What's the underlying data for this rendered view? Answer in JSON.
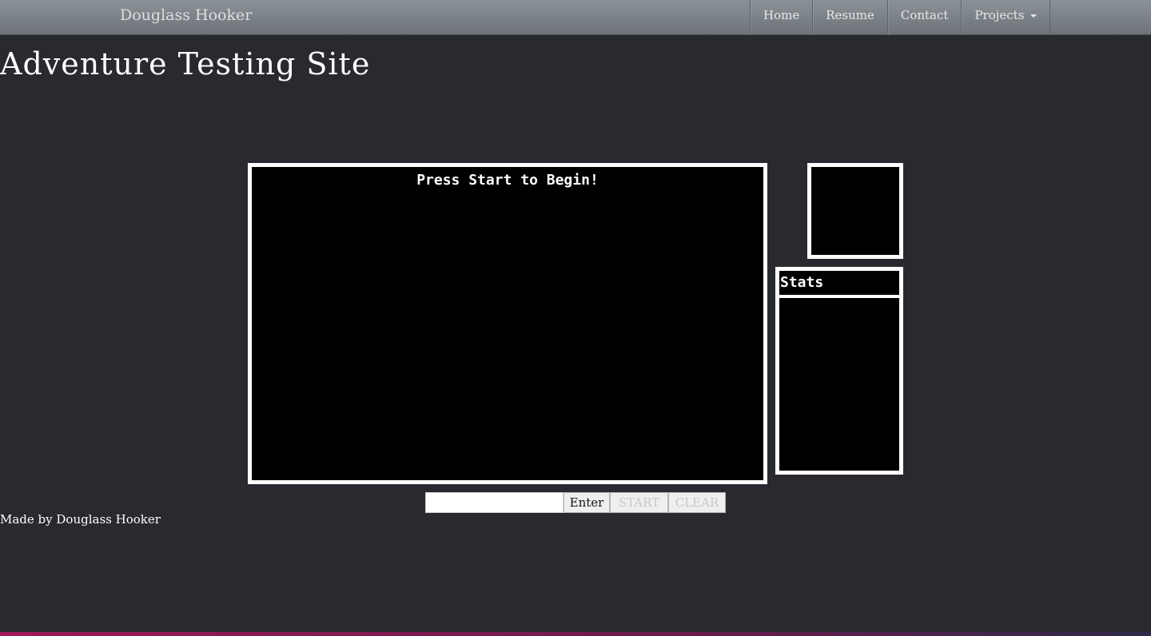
{
  "navbar": {
    "brand": "Douglass Hooker",
    "items": [
      {
        "label": "Home"
      },
      {
        "label": "Resume"
      },
      {
        "label": "Contact"
      },
      {
        "label": "Projects"
      }
    ]
  },
  "page": {
    "title": "Adventure Testing Site"
  },
  "game": {
    "message": "Press Start to Begin!"
  },
  "stats": {
    "header": "Stats"
  },
  "controls": {
    "input_value": "",
    "enter_label": "Enter",
    "start_label": "START",
    "clear_label": "CLEAR"
  },
  "footer": {
    "text": "Made by Douglass Hooker"
  },
  "colors": {
    "background": "#282a2f",
    "navbar": "#7b8287",
    "panel_background": "#000000",
    "panel_border": "#ffffff"
  }
}
